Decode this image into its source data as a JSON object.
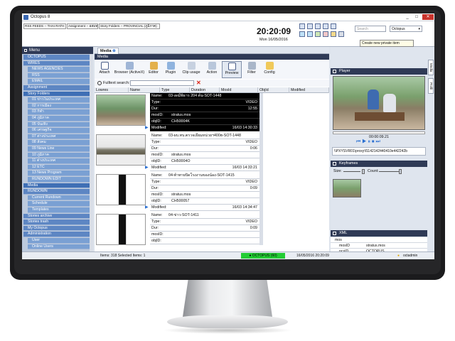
{
  "window": {
    "title": "Octopus 8",
    "controls": [
      "_",
      "□",
      "✕"
    ]
  },
  "toolbar": {
    "tabs": [
      "RSS FEEDS -- THAI RATH",
      "Assignment -- อสมท",
      "Story Folders -- PROVINCIAL (ภูมิภาค)"
    ],
    "clock": "20:20:09",
    "date": "Mon 16/05/2016",
    "search_placeholder": "Search",
    "search_scope": "Octopus",
    "tooltip": "Create new private item"
  },
  "nav": {
    "header": "Menu",
    "items": [
      {
        "label": "OCTOPUS",
        "level": 0
      },
      {
        "label": "WIRES",
        "level": 0
      },
      {
        "label": "NEWS AGENCIES",
        "level": 1
      },
      {
        "label": "RSS",
        "level": 1
      },
      {
        "label": "EMAIL",
        "level": 1
      },
      {
        "label": "Assignment",
        "level": 0
      },
      {
        "label": "Story Folders",
        "level": 0
      },
      {
        "label": "01 ข่าวในประเทศ",
        "level": 1
      },
      {
        "label": "02 การเมือง",
        "level": 1
      },
      {
        "label": "03 กีฬา",
        "level": 1
      },
      {
        "label": "04 ภูมิภาค",
        "level": 1
      },
      {
        "label": "05 บันเทิง",
        "level": 1
      },
      {
        "label": "06 เศรษฐกิจ",
        "level": 1
      },
      {
        "label": "07 ต่างประเทศ",
        "level": 1
      },
      {
        "label": "08 สังคม",
        "level": 1
      },
      {
        "label": "09 News Line",
        "level": 1
      },
      {
        "label": "10 ภูมิภาค",
        "level": 1
      },
      {
        "label": "11 ต่างประเทศ",
        "level": 1
      },
      {
        "label": "12 ETC",
        "level": 1
      },
      {
        "label": "13 News Program",
        "level": 1
      },
      {
        "label": "RUNDOWN EDIT",
        "level": 1
      },
      {
        "label": "Media",
        "level": 0
      },
      {
        "label": "RUNDOWN",
        "level": 0
      },
      {
        "label": "Current Rundown",
        "level": 1
      },
      {
        "label": "Schedule",
        "level": 1
      },
      {
        "label": "Templates",
        "level": 1
      },
      {
        "label": "Stories archive",
        "level": 0
      },
      {
        "label": "Stories trash",
        "level": 0
      },
      {
        "label": "My Octopus",
        "level": 0
      },
      {
        "label": "Administration",
        "level": 0
      },
      {
        "label": "User",
        "level": 1
      },
      {
        "label": "Online Users",
        "level": 1
      }
    ]
  },
  "media": {
    "tab": "Media",
    "header": "Media",
    "tools": [
      "Attach",
      "Browser (ActiveX)",
      "Editor",
      "Plugin",
      "Clip usage",
      "Action",
      "Preview",
      "Filter",
      "Config"
    ],
    "fulltext_label": "Fulltext search:",
    "columns": [
      "Lowres",
      "Name",
      "Type",
      "Duration",
      "MosId",
      "ObjId",
      "Modified"
    ],
    "rows": [
      {
        "name": "03-งดมีพิธาร 204 ต้น-SOT-1448",
        "type": "VIDEO",
        "dur": "12:55",
        "mosid": "stratus.mos",
        "objid": "CH50004K",
        "modified": "16/03 14:30:33"
      },
      {
        "name": "03-ผบ.ทบ.ตรวจเยี่ยมหน่วยฯ400ฮ-SOT-1448",
        "type": "VIDEO",
        "dur": "0:06",
        "mosid": "stratus.mos",
        "objid": "CH50004O",
        "modified": "16/03 14:33:21"
      },
      {
        "name": "04-ท้าทายปิดโรงงานของน้อง-SOT-1415",
        "type": "VIDEO",
        "dur": "0:09",
        "mosid": "stratus.mos",
        "objid": "CH500057",
        "modified": "16/03 14:34:47"
      },
      {
        "name": "04-ข่าว-SOT-1411",
        "type": "VIDEO",
        "dur": "0:09",
        "mosid": "",
        "objid": "",
        "modified": ""
      }
    ],
    "labels": {
      "name": "Name:",
      "type": "Type:",
      "dur": "Dur:",
      "mosid": "mosID:",
      "objid": "objID:",
      "modified": "Modified:"
    }
  },
  "player": {
    "header": "Player",
    "timecode": "00:00:09.21",
    "path": "\\\\PXYSVR01\\proxy\\f1142142440410e442242b"
  },
  "keyframes": {
    "header": "Keyframes",
    "size_label": "Size:",
    "count_label": "Count:"
  },
  "xml": {
    "header": "XML",
    "rows": [
      {
        "k": "mos",
        "v": ""
      },
      {
        "k": "mosID",
        "v": "stratus.mos"
      },
      {
        "k": "ncsID",
        "v": "OCTOPUS"
      }
    ]
  },
  "sidetabs": [
    "Media",
    "Profil"
  ],
  "status": {
    "items": "Items: 318  Selected Items: 1",
    "server": "OCTOPUS (60)",
    "datetime": "16/05/2016 20:20:09",
    "user": "octadmin"
  },
  "colors": {
    "bezel": "#1b1b1d",
    "nav_header": "#2f3a56",
    "nav_item": "#5d86c3",
    "status_ok": "#22cc33"
  }
}
